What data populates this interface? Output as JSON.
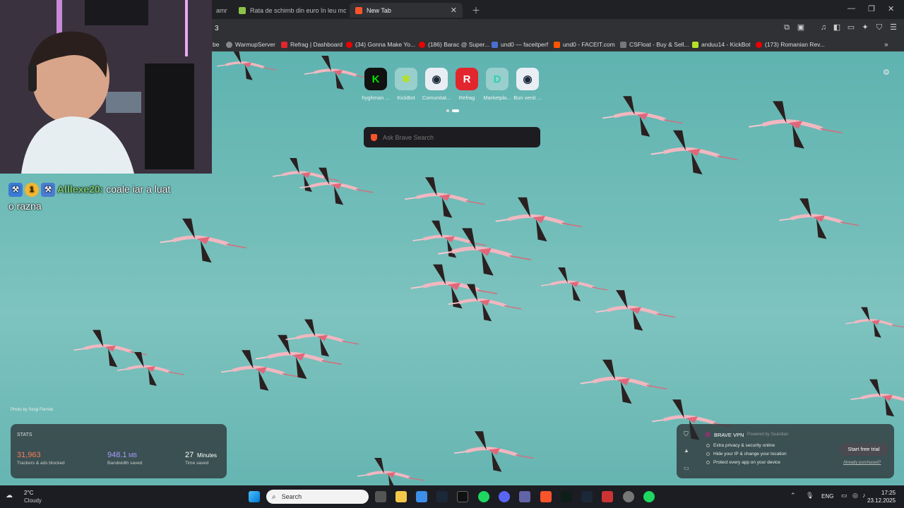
{
  "tabs": [
    {
      "label": "amr",
      "active": false
    },
    {
      "label": "Rata de schimb din euro în leu moldo",
      "active": false
    },
    {
      "label": "New Tab",
      "active": true
    }
  ],
  "address": {
    "value": "3"
  },
  "bookmarks": [
    {
      "label": "be"
    },
    {
      "label": "WarmupServer"
    },
    {
      "label": "Refrag | Dashboard"
    },
    {
      "label": "(34) Gonna Make Yo..."
    },
    {
      "label": "(186) Barac @ Super..."
    },
    {
      "label": "und0 — faceitperf"
    },
    {
      "label": "und0 - FACEIT.com"
    },
    {
      "label": "CSFloat - Buy & Sell..."
    },
    {
      "label": "anduu14 - KickBot"
    },
    {
      "label": "(173) Romanian Rev..."
    }
  ],
  "top_sites": [
    {
      "label": "hyghman ...",
      "glyph": "K"
    },
    {
      "label": "KickBot",
      "glyph": "✱"
    },
    {
      "label": "Comunitat...",
      "glyph": "◉"
    },
    {
      "label": "Refrag",
      "glyph": "R"
    },
    {
      "label": "Marketpla...",
      "glyph": "D"
    },
    {
      "label": "Bun venit ...",
      "glyph": "◉"
    }
  ],
  "search": {
    "placeholder": "Ask Brave Search"
  },
  "chat": {
    "username": "Alllexe20:",
    "badge_number": "1",
    "message_part1": "coale iar a luat",
    "message_part2": "o razna"
  },
  "photo_credit": "Photo by Sergi Ferrete",
  "stats": {
    "title": "STATS",
    "trackers_value": "31,963",
    "trackers_label": "Trackers & ads blocked",
    "bandwidth_value": "948.1",
    "bandwidth_unit": "MB",
    "bandwidth_label": "Bandwidth saved",
    "time_value": "27",
    "time_unit": "Minutes",
    "time_label": "Time saved"
  },
  "vpn": {
    "title": "BRAVE VPN",
    "powered": "Powered by Guardian",
    "bullets": [
      "Extra privacy & security online",
      "Hide your IP & change your location",
      "Protect every app on your device"
    ],
    "cta": "Start free trial",
    "link": "Already purchased?"
  },
  "taskbar": {
    "weather_temp": "2°C",
    "weather_cond": "Cloudy",
    "search_label": "Search",
    "lang": "ENG",
    "time": "17:25",
    "date": "23.12.2025"
  },
  "colors": {
    "trackers": "#ff7a5c",
    "bandwidth": "#a79cff",
    "accent": "#fb542b"
  }
}
